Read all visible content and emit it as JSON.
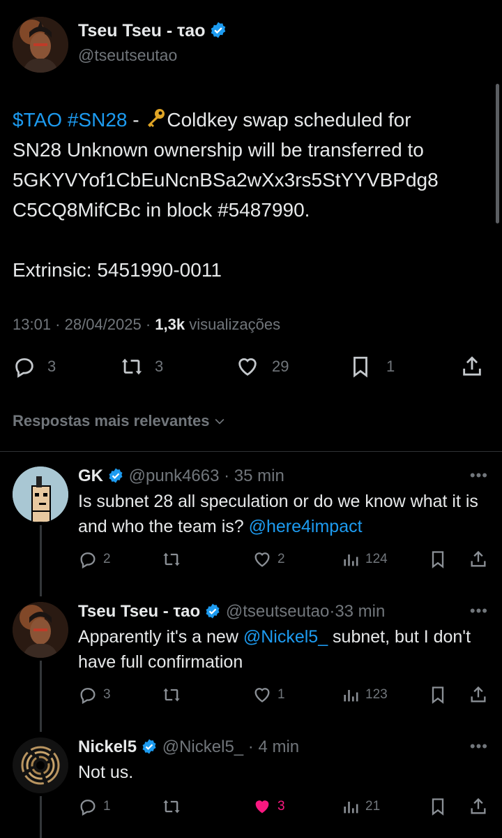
{
  "tweet": {
    "author_name": "Tseu Tseu - τao",
    "author_handle": "@tseutseutao",
    "text_cashtag": "$TAO",
    "text_hashtag": "#SN28",
    "text_sep": " - ",
    "text_line1_rest": "Coldkey swap scheduled for",
    "text_line2": "SN28 Unknown ownership will be transferred to",
    "text_line3": "5GKYVYof1CbEuNcnBSa2wXx3rs5StYYVBPdg8",
    "text_line4": "C5CQ8MifCBc in block #5487990.",
    "text_line5": "Extrinsic: 5451990-0011",
    "time": "13:01",
    "date": "28/04/2025",
    "views_count": "1,3k",
    "views_label": "visualizações",
    "replies": "3",
    "reposts": "3",
    "likes": "29",
    "bookmarks": "1",
    "accent_color": "#1d9bf0"
  },
  "sort_label": "Respostas mais relevantes",
  "replies": [
    {
      "name": "GK",
      "handle": "@punk4663",
      "time": "35 min",
      "text_a": "Is subnet 28 all speculation or do we know what it is and who the team is? ",
      "mention": "@here4impact",
      "text_b": "",
      "replies": "2",
      "reposts": "",
      "likes": "2",
      "views": "124"
    },
    {
      "name": "Tseu Tseu - τao",
      "handle": "@tseutseutao",
      "time": "33 min",
      "text_a": "Apparently it's a new ",
      "mention": "@Nickel5_",
      "text_b": " subnet, but I don't have full confirmation",
      "replies": "3",
      "reposts": "",
      "likes": "1",
      "views": "123"
    },
    {
      "name": "Nickel5",
      "handle": "@Nickel5_",
      "time": "4 min",
      "text_a": "Not us.",
      "mention": "",
      "text_b": "",
      "replies": "1",
      "reposts": "",
      "likes": "3",
      "views": "21",
      "liked_color": "#f91880"
    }
  ]
}
